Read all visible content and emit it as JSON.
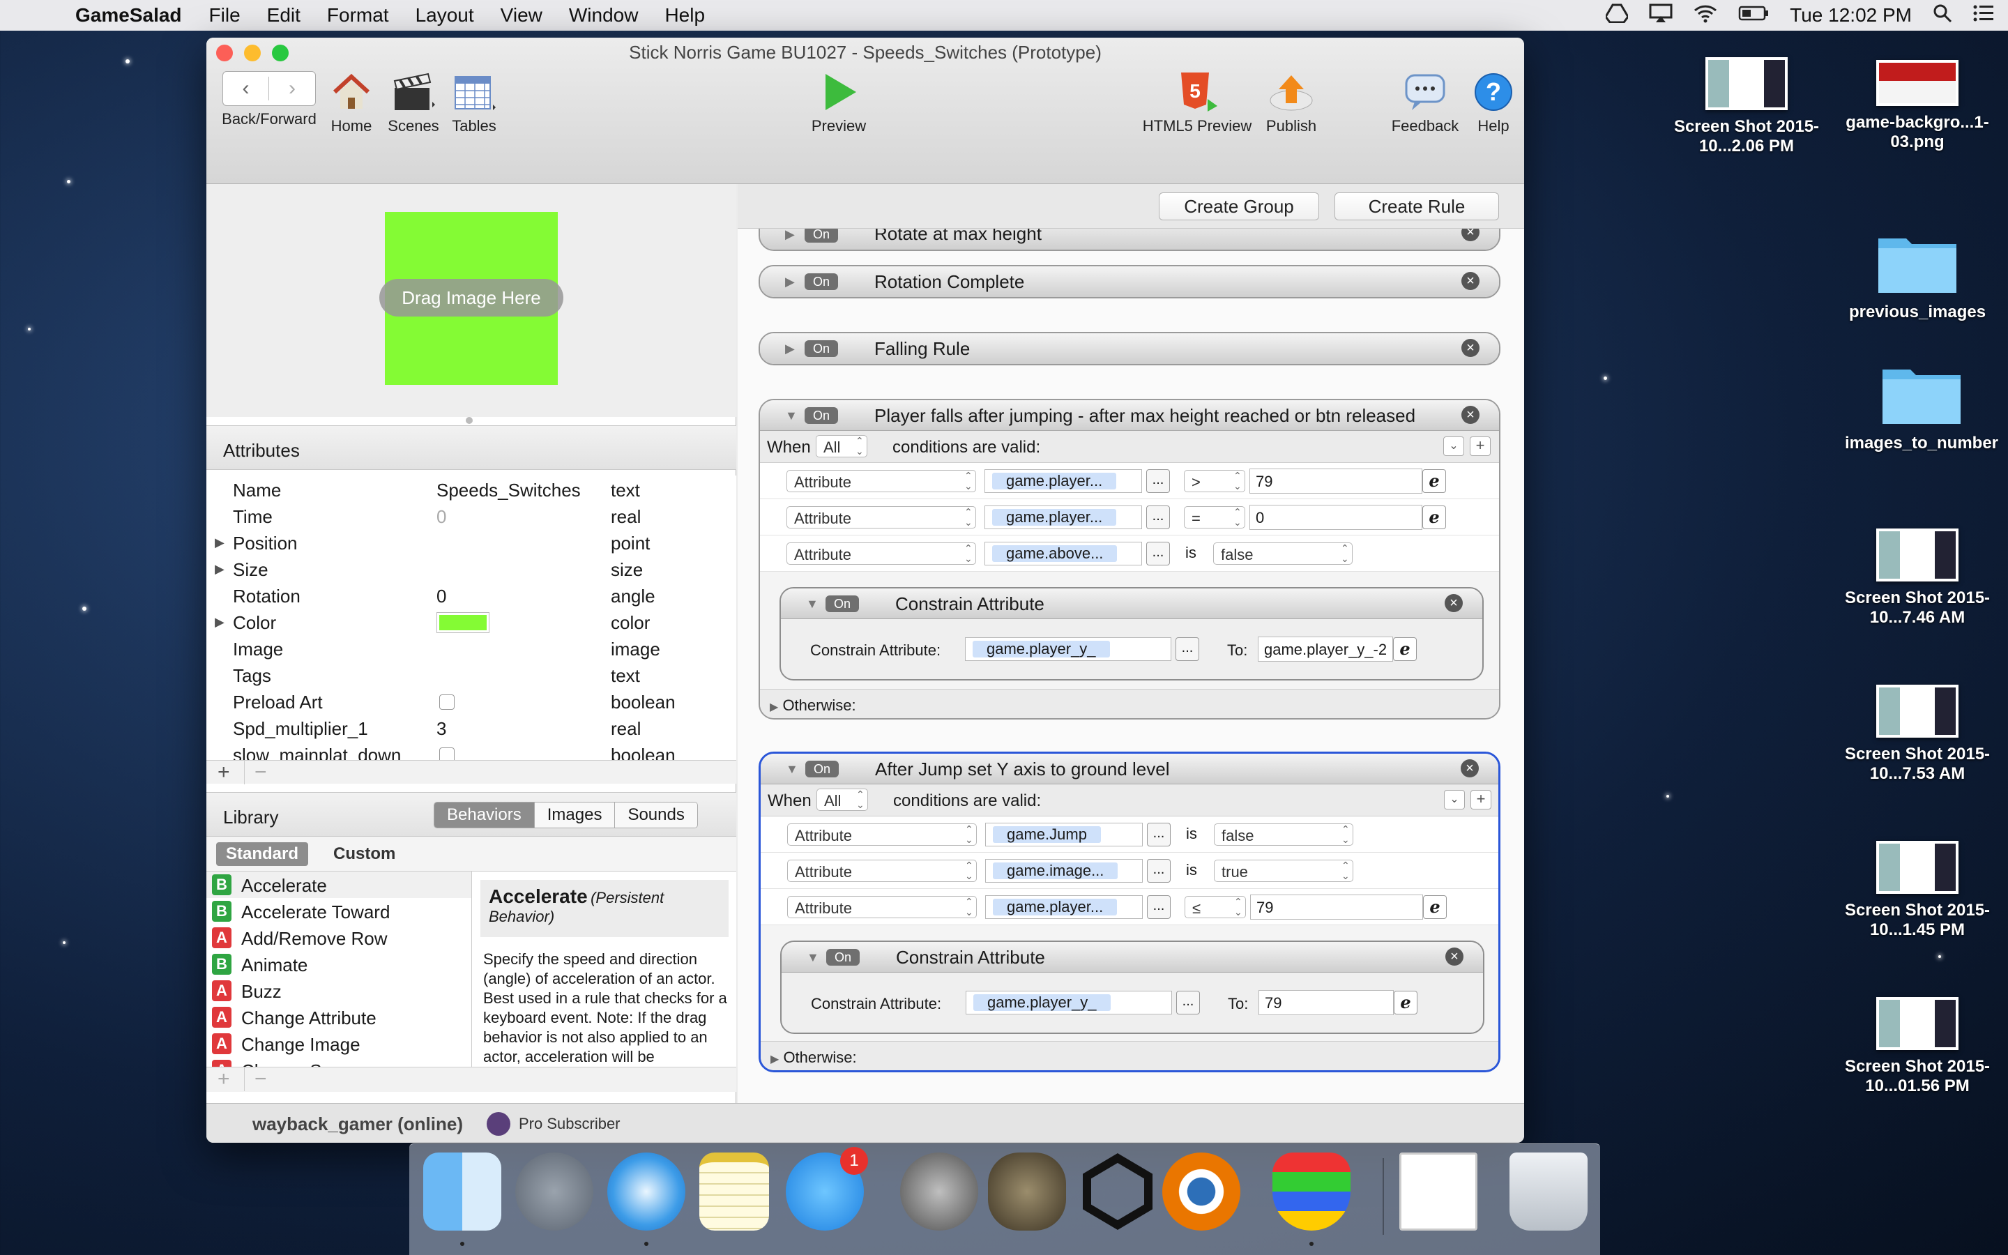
{
  "menubar": {
    "app": "GameSalad",
    "items": [
      "File",
      "Edit",
      "Format",
      "Layout",
      "View",
      "Window",
      "Help"
    ],
    "clock": "Tue 12:02 PM"
  },
  "window": {
    "title": "Stick Norris Game BU1027 - Speeds_Switches (Prototype)"
  },
  "toolbar": {
    "back_forward": "Back/Forward",
    "home": "Home",
    "scenes": "Scenes",
    "tables": "Tables",
    "preview": "Preview",
    "html5": "HTML5 Preview",
    "publish": "Publish",
    "feedback": "Feedback",
    "help": "Help"
  },
  "image_well": {
    "label": "Drag Image Here",
    "color": "#84fb34"
  },
  "attributes": {
    "header": "Attributes",
    "rows": [
      {
        "name": "Name",
        "value": "Speeds_Switches",
        "type": "text"
      },
      {
        "name": "Time",
        "value": "0",
        "type": "real"
      },
      {
        "name": "Position",
        "value": "",
        "type": "point"
      },
      {
        "name": "Size",
        "value": "",
        "type": "size"
      },
      {
        "name": "Rotation",
        "value": "0",
        "type": "angle"
      },
      {
        "name": "Color",
        "value": "",
        "type": "color"
      },
      {
        "name": "Image",
        "value": "",
        "type": "image"
      },
      {
        "name": "Tags",
        "value": "",
        "type": "text"
      },
      {
        "name": "Preload Art",
        "value": "",
        "type": "boolean"
      },
      {
        "name": "Spd_multiplier_1",
        "value": "3",
        "type": "real"
      },
      {
        "name": "slow_mainplat_down",
        "value": "",
        "type": "boolean"
      }
    ],
    "add": "+",
    "remove": "−"
  },
  "library": {
    "header": "Library",
    "tabs": [
      "Behaviors",
      "Images",
      "Sounds"
    ],
    "subtabs": [
      "Standard",
      "Custom"
    ],
    "items": [
      {
        "badge": "B",
        "label": "Accelerate"
      },
      {
        "badge": "B",
        "label": "Accelerate Toward"
      },
      {
        "badge": "A",
        "label": "Add/Remove Row"
      },
      {
        "badge": "B",
        "label": "Animate"
      },
      {
        "badge": "A",
        "label": "Buzz"
      },
      {
        "badge": "A",
        "label": "Change Attribute"
      },
      {
        "badge": "A",
        "label": "Change Image"
      },
      {
        "badge": "A",
        "label": "Change Scene"
      }
    ],
    "desc_title": "Accelerate",
    "desc_sub": "(Persistent Behavior)",
    "desc_body": "Specify the speed and direction (angle) of acceleration of an actor. Best used in a rule that checks for a keyboard event. Note: If the drag behavior is not also applied to an actor, acceleration will be continuously"
  },
  "editor": {
    "create_group": "Create Group",
    "create_rule": "Create Rule",
    "on_label": "On",
    "rules_collapsed": [
      "Rotate at max height",
      "Rotation Complete",
      "Falling Rule"
    ],
    "rule1": {
      "title": "Player falls after jumping - after max height reached or btn released",
      "when": "When",
      "mode": "All",
      "cond_text": "conditions are valid:",
      "conds": [
        {
          "type": "Attribute",
          "attr": "game.player...",
          "op": ">",
          "value": "79"
        },
        {
          "type": "Attribute",
          "attr": "game.player...",
          "op": "=",
          "value": "0"
        },
        {
          "type": "Attribute",
          "attr": "game.above...",
          "op": "is",
          "value": "false"
        }
      ],
      "behavior": {
        "title": "Constrain Attribute",
        "label": "Constrain Attribute:",
        "attr": "game.player_y_",
        "to_label": "To:",
        "to": "game.player_y_-2"
      },
      "otherwise": "Otherwise:"
    },
    "rule2": {
      "title": "After Jump set Y axis to ground level",
      "when": "When",
      "mode": "All",
      "cond_text": "conditions are valid:",
      "conds": [
        {
          "type": "Attribute",
          "attr": "game.Jump",
          "op": "is",
          "value": "false"
        },
        {
          "type": "Attribute",
          "attr": "game.image...",
          "op": "is",
          "value": "true"
        },
        {
          "type": "Attribute",
          "attr": "game.player...",
          "op": "≤",
          "value": "79"
        }
      ],
      "behavior": {
        "title": "Constrain Attribute",
        "label": "Constrain Attribute:",
        "attr": "game.player_y_",
        "to_label": "To:",
        "to": "79"
      },
      "otherwise": "Otherwise:"
    }
  },
  "status": {
    "user": "wayback_gamer (online)",
    "plan": "Pro Subscriber"
  },
  "desktop": [
    {
      "label": "Screen Shot 2015-10...2.06 PM",
      "kind": "thumb"
    },
    {
      "label": "game-backgro...1-03.png",
      "kind": "image"
    },
    {
      "label": "previous_images",
      "kind": "folder"
    },
    {
      "label": "images_to_number",
      "kind": "folder"
    },
    {
      "label": "Screen Shot 2015-10...7.46 AM",
      "kind": "thumb"
    },
    {
      "label": "Screen Shot 2015-10...7.53 AM",
      "kind": "thumb"
    },
    {
      "label": "Screen Shot 2015-10...1.45 PM",
      "kind": "thumb"
    },
    {
      "label": "Screen Shot 2015-10...01.56 PM",
      "kind": "thumb"
    }
  ],
  "dock": {
    "appstore_badge": "1"
  }
}
